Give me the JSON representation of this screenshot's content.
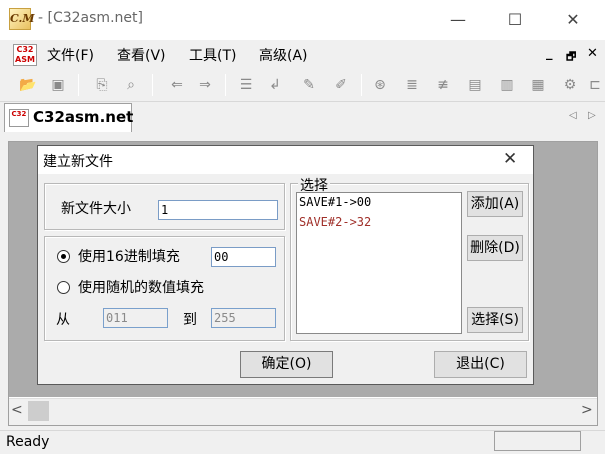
{
  "window": {
    "logo_text": "C.M",
    "title": "- [C32asm.net]",
    "minimize": "—",
    "maximize": "☐",
    "close": "✕"
  },
  "menu": {
    "logo_text": "C32 ASM",
    "items": [
      {
        "label": "文件(F)"
      },
      {
        "label": "查看(V)"
      },
      {
        "label": "工具(T)"
      },
      {
        "label": "高级(A)"
      }
    ],
    "mdi_min": "_",
    "mdi_restore": "🗗",
    "mdi_close": "✕"
  },
  "toolbar": {
    "icons": [
      "open-folder-icon",
      "save-icon",
      "copy-icon",
      "find-icon",
      "back-arrow-icon",
      "forward-arrow-icon",
      "goto-icon",
      "return-icon",
      "patch-icon",
      "unpatch-icon",
      "analyze-icon",
      "list-icon",
      "align-icon",
      "hex-icon",
      "data-icon",
      "bytes-icon",
      "gear-icon",
      "more-icon"
    ]
  },
  "tab": {
    "icon_text": "C32",
    "label": "C32asm.net",
    "arrow_left": "◁",
    "arrow_right": "▷"
  },
  "dialog": {
    "title": "建立新文件",
    "close": "✕",
    "size_label": "新文件大小",
    "size_value": "1",
    "fill_hex_label": "使用16进制填充",
    "fill_hex_value": "00",
    "fill_random_label": "使用随机的数值填充",
    "from_label": "从",
    "from_value": "011",
    "to_label": "到",
    "to_value": "255",
    "select_group_label": "选择",
    "list_items": [
      {
        "text": "SAVE#1->00",
        "color": "#000000"
      },
      {
        "text": "SAVE#2->32",
        "color": "#a0302a"
      }
    ],
    "add_button": "添加(A)",
    "delete_button": "删除(D)",
    "select_button": "选择(S)",
    "ok_button": "确定(O)",
    "exit_button": "退出(C)"
  },
  "scrollbar": {
    "left": "<",
    "right": ">"
  },
  "status": {
    "text": "Ready"
  }
}
